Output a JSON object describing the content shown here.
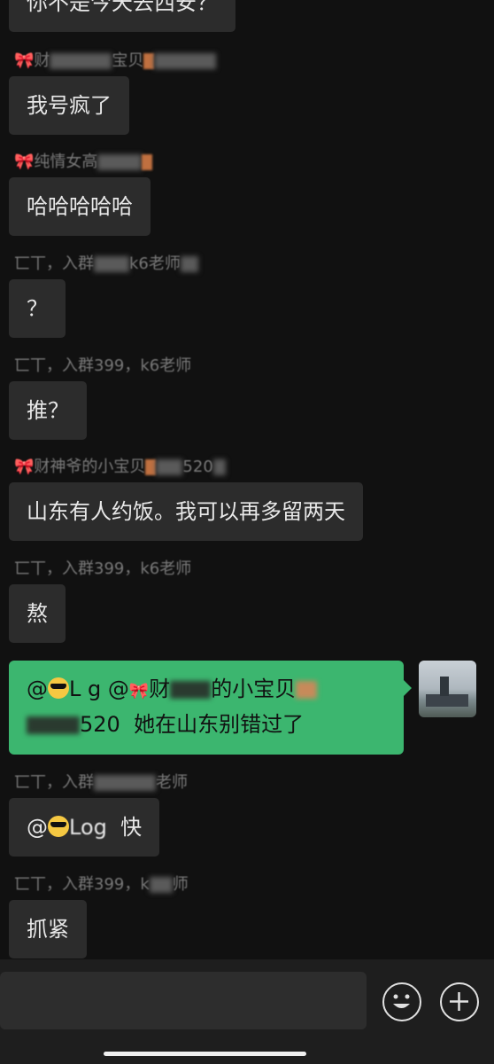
{
  "messages": [
    {
      "sender": "",
      "text": "你不是今天去西安？"
    },
    {
      "sender": "🎀财",
      "sender_tail": "宝贝",
      "text": "我号疯了"
    },
    {
      "sender": "🎀纯情女高",
      "text": "哈哈哈哈哈"
    },
    {
      "sender": "匸丅，入群",
      "sender_tail": "k6老师",
      "text": "？"
    },
    {
      "sender": "匸丅，入群399，k6老师",
      "text": "推？"
    },
    {
      "sender": "🎀财神爷的小宝贝",
      "sender_tail": "520",
      "text": "山东有人约饭。我可以再多留两天"
    },
    {
      "sender": "匸丅，入群399，k6老师",
      "text": "熬"
    },
    {
      "sender": "匸丅，入群",
      "sender_tail": "老师",
      "text_prefix": "@",
      "mention": "Log",
      "text": "快"
    },
    {
      "sender": "匸丅，入群399，k",
      "sender_tail": "师",
      "text": "抓紧"
    }
  ],
  "sent_message": {
    "line1_prefix": "@",
    "line1_name": "L  g @",
    "line1_name2": "财",
    "line1_tail": "的小宝贝",
    "line2_tail": "520",
    "line2_text": "她在山东别错过了"
  },
  "colors": {
    "background": "#111111",
    "bubble_received": "#2c2c2c",
    "bubble_sent": "#3cb66f",
    "text": "#e8e8e8"
  },
  "icons": [
    "emoji-face-icon",
    "plus-icon"
  ]
}
